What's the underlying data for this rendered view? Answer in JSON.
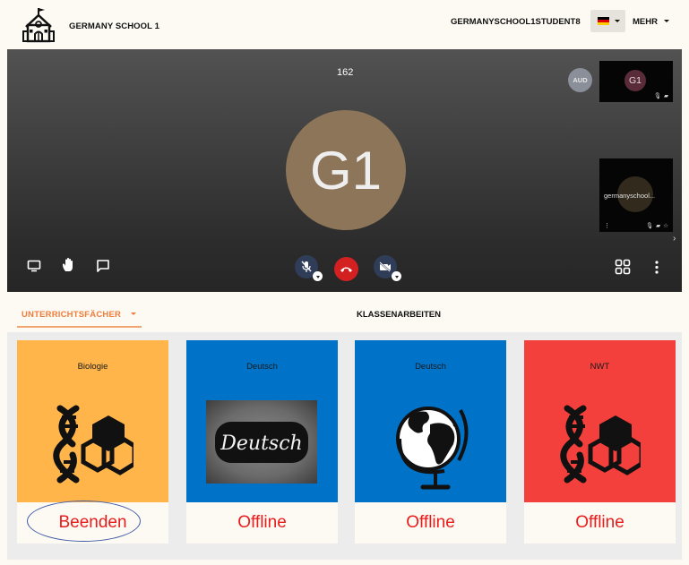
{
  "header": {
    "school_name": "GERMANY SCHOOL 1",
    "username": "GERMANYSCHOOL1STUDENT8",
    "language_flag": "flag-germany-icon",
    "more_label": "MEHR"
  },
  "video": {
    "participant_count": "162",
    "main_avatar_initials": "G1",
    "audio_badge": "AUD",
    "thumb1_initials": "G1",
    "thumb2_name": "germanyschool..."
  },
  "tabs": {
    "subjects_label": "UNTERRICHTSFÄCHER",
    "exams_label": "KLASSENARBEITEN"
  },
  "cards": [
    {
      "title": "Biologie",
      "status": "Beenden",
      "color": "#ffb54a",
      "icon": "dna-hexagon-icon"
    },
    {
      "title": "Deutsch",
      "status": "Offline",
      "color": "#0073c8",
      "icon": "chalkboard-deutsch-image",
      "image_text": "Deutsch"
    },
    {
      "title": "Deutsch",
      "status": "Offline",
      "color": "#0073c8",
      "icon": "globe-icon"
    },
    {
      "title": "NWT",
      "status": "Offline",
      "color": "#f4403d",
      "icon": "dna-hexagon-icon"
    }
  ],
  "colors": {
    "accent_orange": "#ef7d3c",
    "status_red": "#e81c1c",
    "end_call_red": "#d32020",
    "control_blue": "#2f3d59"
  }
}
